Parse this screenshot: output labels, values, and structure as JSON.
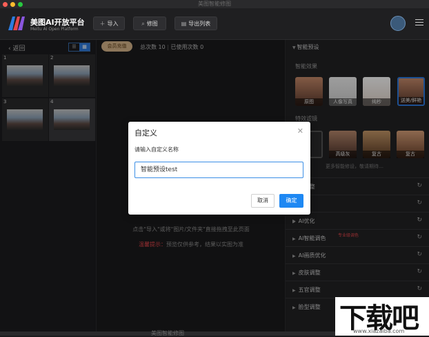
{
  "window": {
    "title": "美图智能修图"
  },
  "brand": {
    "title": "美图AI开放平台",
    "subtitle": "Meitu AI Open Platform"
  },
  "toolbar": {
    "import_label": "导入",
    "retouch_label": "修图",
    "export_list_label": "导出列表"
  },
  "left": {
    "back_label": "返回",
    "thumbnails": [
      {
        "index": "1"
      },
      {
        "index": "2"
      },
      {
        "index": "3"
      },
      {
        "index": "4"
      }
    ]
  },
  "center": {
    "member_label": "会员充值",
    "total_count": "总次数 10",
    "used_count": "已使用次数 0",
    "hint": "点击\"导入\"或将\"图片/文件夹\"直接拖拽至此页面",
    "tip_label": "温馨提示：",
    "tip_text": "预览仅供参考，结果以实图为准"
  },
  "right": {
    "section_title": "智能预设",
    "effects_title": "智能效果",
    "effects": [
      "原图",
      "人像写真",
      "纯秒",
      "送美/鲜艳"
    ],
    "filters_title": "特效滤镜",
    "filters": [
      "高级灰",
      "复古",
      "复古"
    ],
    "more_text": "更多智能修设，敬请期待…",
    "rows": [
      {
        "name": "…调整"
      },
      {
        "name": ""
      },
      {
        "name": ""
      },
      {
        "name": "AI优化"
      },
      {
        "name": "AI智能调色",
        "tag": "专业级调色"
      },
      {
        "name": "AI画质优化"
      },
      {
        "name": "皮肤调整"
      },
      {
        "name": "五官调整"
      },
      {
        "name": "脸型调整"
      }
    ]
  },
  "dialog": {
    "title": "自定义",
    "prompt": "请输入自定义名称",
    "input_value": "智能预设test",
    "cancel_label": "取消",
    "ok_label": "确定"
  },
  "watermark": {
    "text": "下载吧",
    "url": "www.xiazaiba.com"
  },
  "colors": {
    "accent": "#1e88f3",
    "member": "#d7b58a",
    "warn": "#e5464b"
  }
}
